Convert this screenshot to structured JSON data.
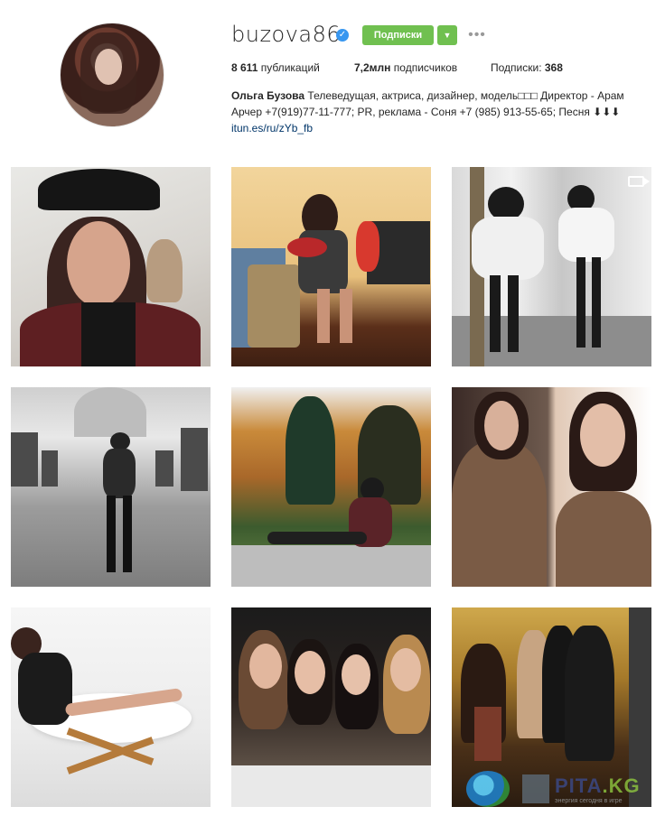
{
  "profile": {
    "username": "buzova86",
    "verified_icon": "verified-check-icon",
    "follow_label": "Подписки",
    "dropdown_icon": "caret-down-icon",
    "more_icon": "ellipsis-icon",
    "stats": {
      "posts_value": "8 611",
      "posts_label": "публикаций",
      "followers_value": "7,2млн",
      "followers_label": "подписчиков",
      "following_label": "Подписки:",
      "following_value": "368"
    },
    "bio": {
      "name": "Ольга Бузова",
      "text": "Телеведущая, актриса, дизайнер, модель□□□ Директор - Арам Арчер +7(919)77-11-777; PR, реклама - Соня +7 (985) 913-55-65; Песня ⬇⬇⬇",
      "link": "itun.es/ru/zYb_fb"
    }
  },
  "colors": {
    "follow_green": "#70c050",
    "verified_blue": "#3897f0",
    "link_blue": "#003569"
  },
  "grid": {
    "posts": [
      {
        "subject": "selfie-black-cap",
        "video": false
      },
      {
        "subject": "room-with-suitcase",
        "video": false
      },
      {
        "subject": "mirror-white-sweater",
        "video": true
      },
      {
        "subject": "museum-gallery",
        "video": false
      },
      {
        "subject": "autumn-park",
        "video": false
      },
      {
        "subject": "fur-coat-collage",
        "video": false
      },
      {
        "subject": "white-chair-pose",
        "video": false
      },
      {
        "subject": "restaurant-friends",
        "video": false
      },
      {
        "subject": "group-night-street",
        "video": false
      }
    ]
  },
  "watermark": {
    "brand_main": "PITA",
    "brand_suffix": ".KG",
    "tagline": "энергия сегодня в игре"
  }
}
